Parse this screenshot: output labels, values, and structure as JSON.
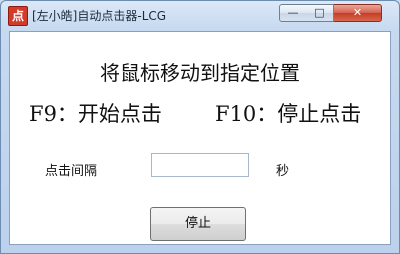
{
  "window": {
    "title": "[左小皓]自动点击器-LCG",
    "app_icon_glyph": "点",
    "controls": {
      "minimize": "—",
      "maximize": "□",
      "close": "✕"
    }
  },
  "main": {
    "instruction": "将鼠标移动到指定位置",
    "f9_hint": "F9：开始点击",
    "f10_hint": "F10：停止点击",
    "interval_label": "点击间隔",
    "interval_value": "",
    "interval_unit": "秒",
    "stop_button_label": "停止"
  },
  "colors": {
    "close_button": "#c43d28",
    "title_bar": "#c6d9f0"
  }
}
